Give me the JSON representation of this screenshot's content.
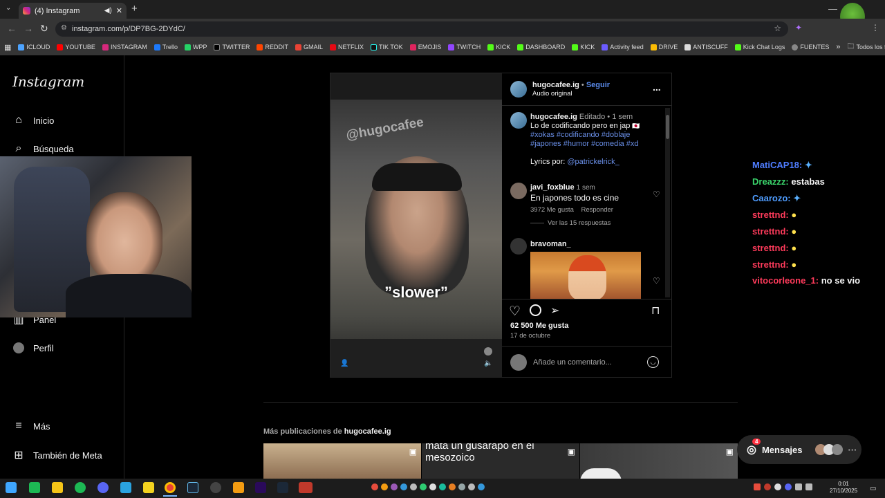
{
  "browser": {
    "tab_title": "(4) Instagram",
    "url": "instagram.com/p/DP7BG-2DYdC/",
    "bookmarks": [
      "ICLOUD",
      "YOUTUBE",
      "INSTAGRAM",
      "Trello",
      "WPP",
      "TWITTER",
      "REDDIT",
      "GMAIL",
      "NETFLIX",
      "TIK TOK",
      "EMOJIS",
      "TWITCH",
      "KICK",
      "DASHBOARD",
      "KICK",
      "Activity feed",
      "DRIVE",
      "ANTISCUFF",
      "Kick Chat Logs",
      "FUENTES"
    ],
    "bookmarks_more": "»",
    "all_bookmarks": "Todos los favoritos"
  },
  "sidebar": {
    "logo": "Instagram",
    "items": [
      {
        "label": "Inicio",
        "icon": "home-icon"
      },
      {
        "label": "Búsqueda",
        "icon": "search-icon"
      },
      {
        "label": "Panel",
        "icon": "dashboard-icon"
      },
      {
        "label": "Perfil",
        "icon": "profile-avatar"
      },
      {
        "label": "Más",
        "icon": "menu-icon"
      },
      {
        "label": "También de Meta",
        "icon": "meta-icon"
      }
    ]
  },
  "post": {
    "author": "hugocafee.ig",
    "follow": "Seguir",
    "dot": "•",
    "audio": "Audio original",
    "more": "...",
    "watermark": "@hugocafee",
    "video_caption": "”slower”",
    "caption": {
      "author": "hugocafee.ig",
      "edited": "Editado",
      "age": "1 sem",
      "text": "Lo de codificando pero en jap",
      "hashtags": "#xokas #codificando #doblaje #japones #humor #comedia #xd",
      "lyrics_label": "Lyrics por:",
      "lyrics_user": "@patrickelrick_"
    },
    "comments": [
      {
        "author": "javi_foxblue",
        "age": "1 sem",
        "text": "En japones todo es cine",
        "likes": "3972 Me gusta",
        "reply": "Responder",
        "view_replies": "Ver las 15 respuestas"
      },
      {
        "author": "bravoman_"
      }
    ],
    "likes": "62 500 Me gusta",
    "date": "17 de octubre",
    "comment_placeholder": "Añade un comentario..."
  },
  "more_posts": {
    "label": "Más publicaciones de",
    "user": "hugocafee.ig",
    "thumb2_text": "mata un gusarapo en el mesozoico"
  },
  "messages": {
    "label": "Mensajes",
    "badge": "4"
  },
  "chat": [
    {
      "user": "MatiCAP18:",
      "msg": "",
      "color": "#4f7dff"
    },
    {
      "user": "Dreazzz:",
      "msg": "estabas",
      "color": "#3ad46b"
    },
    {
      "user": "Caarozo:",
      "msg": "",
      "color": "#4f9dff"
    },
    {
      "user": "strettnd:",
      "msg": "",
      "color": "#ff3b5b"
    },
    {
      "user": "strettnd:",
      "msg": "",
      "color": "#ff3b5b"
    },
    {
      "user": "strettnd:",
      "msg": "",
      "color": "#ff3b5b"
    },
    {
      "user": "strettnd:",
      "msg": "",
      "color": "#ff3b5b"
    },
    {
      "user": "vitocorleone_1:",
      "msg": "no se vio",
      "color": "#ff3b5b"
    }
  ],
  "clock": {
    "time": "0:01",
    "date": "27/10/2025"
  }
}
